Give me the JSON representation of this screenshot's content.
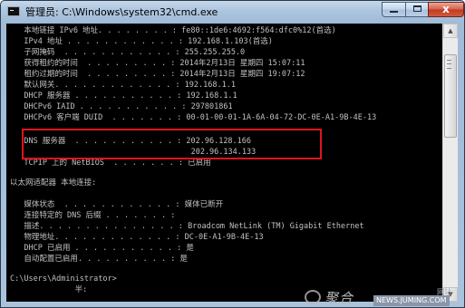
{
  "window": {
    "title": "管理员: C:\\Windows\\system32\\cmd.exe",
    "close_glyph": "x",
    "icon": "cmd-console-icon"
  },
  "console": {
    "lines": [
      "   本地链接 IPv6 地址. . . . . . . . : fe80::1de6:4692:f564:dfc0%12(首选)",
      "   IPv4 地址 . . . . . . . . . . . . : 192.168.1.103(首选)",
      "   子网掩码  . . . . . . . . . . . . : 255.255.255.0",
      "   获得租约的时间  . . . . . . . . . : 2014年2月13日 星期四 15:07:11",
      "   租约过期的时间  . . . . . . . . . : 2014年2月13日 星期四 19:07:12",
      "   默认网关. . . . . . . . . . . . . : 192.168.1.1",
      "   DHCP 服务器 . . . . . . . . . . . : 192.168.1.1",
      "   DHCPv6 IAID . . . . . . . . . . . : 297801861",
      "   DHCPv6 客户端 DUID  . . . . . . . : 00-01-00-01-1A-6A-04-72-DC-0E-A1-9B-4E-13",
      "",
      "   DNS 服务器  . . . . . . . . . . . : 202.96.128.166",
      "                                       202.96.134.133",
      "   TCPIP 上的 NetBIOS  . . . . . . . : 已启用",
      "",
      "以太网适配器 本地连接:",
      "",
      "   媒体状态  . . . . . . . . . . . . : 媒体已断开",
      "   连接特定的 DNS 后缀 . . . . . . . :",
      "   描述. . . . . . . . . . . . . . . : Broadcom NetLink (TM) Gigabit Ethernet",
      "   物理地址. . . . . . . . . . . . . : DC-0E-A1-9B-4E-13",
      "   DHCP 已启用 . . . . . . . . . . . : 是",
      "   自动配置已启用. . . . . . . . . . : 是",
      "",
      "C:\\Users\\Administrator>",
      "              半:"
    ]
  },
  "watermark": {
    "logo_text": "聚合",
    "site": "NEWS.JUMING.COM",
    "label": "网站"
  },
  "colors": {
    "console_bg": "#000000",
    "console_text": "#c0c0c0",
    "highlight": "#e0141c",
    "titlebar": "#a9c3de",
    "close_button": "#c13a22"
  }
}
